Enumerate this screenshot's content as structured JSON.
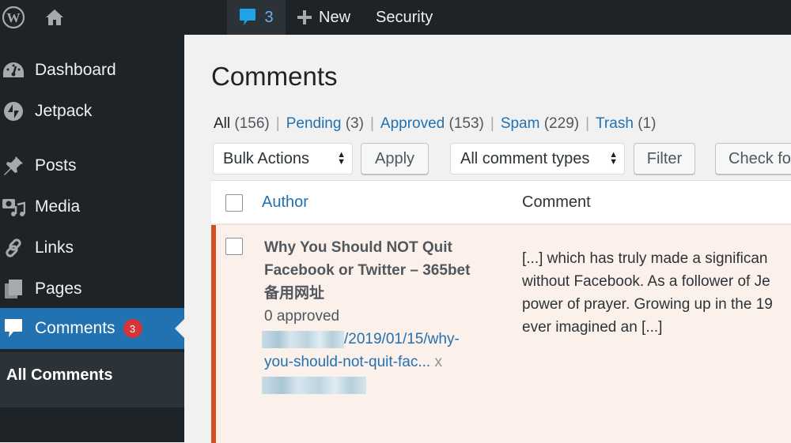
{
  "adminbar": {
    "wp_logo": "wordpress-logo-icon",
    "home": "home-icon",
    "comments_count": "3",
    "new_label": "New",
    "security_label": "Security"
  },
  "sidebar": {
    "items": [
      {
        "label": "Dashboard",
        "icon": "dashboard-icon"
      },
      {
        "label": "Jetpack",
        "icon": "jetpack-icon"
      },
      {
        "label": "Posts",
        "icon": "pin-icon"
      },
      {
        "label": "Media",
        "icon": "media-icon"
      },
      {
        "label": "Links",
        "icon": "link-icon"
      },
      {
        "label": "Pages",
        "icon": "pages-icon"
      },
      {
        "label": "Comments",
        "icon": "comment-icon",
        "badge": "3",
        "current": true
      }
    ],
    "submenu": [
      {
        "label": "All Comments"
      }
    ]
  },
  "page": {
    "title": "Comments",
    "filters": [
      {
        "label": "All",
        "count": "(156)"
      },
      {
        "label": "Pending",
        "count": "(3)"
      },
      {
        "label": "Approved",
        "count": "(153)"
      },
      {
        "label": "Spam",
        "count": "(229)"
      },
      {
        "label": "Trash",
        "count": "(1)"
      }
    ],
    "separator": "|",
    "bulk_actions": "Bulk Actions",
    "apply_label": "Apply",
    "comment_types": "All comment types",
    "filter_label": "Filter",
    "check_label": "Check fo"
  },
  "table": {
    "headers": {
      "author": "Author",
      "comment": "Comment"
    },
    "rows": [
      {
        "author_line1": "Why You Should NOT Quit",
        "author_line2": "Facebook or Twitter – 365bet",
        "author_line3": "备用网址",
        "approved": "0 approved",
        "url_part1": "/2019/01/15/why-",
        "url_part2": "you-should-not-quit-fac...",
        "remove": "x",
        "comment_lines": [
          "[...] which has truly made a significan",
          "without Facebook. As a follower of Je",
          "power of prayer. Growing up in the 19",
          "ever imagined an [...]"
        ]
      }
    ]
  },
  "colors": {
    "accent": "#2271b1",
    "admin_bg": "#1d2327",
    "badge": "#d63638",
    "pending_border": "#d54e21",
    "pending_row_bg": "#fcf0ea"
  }
}
